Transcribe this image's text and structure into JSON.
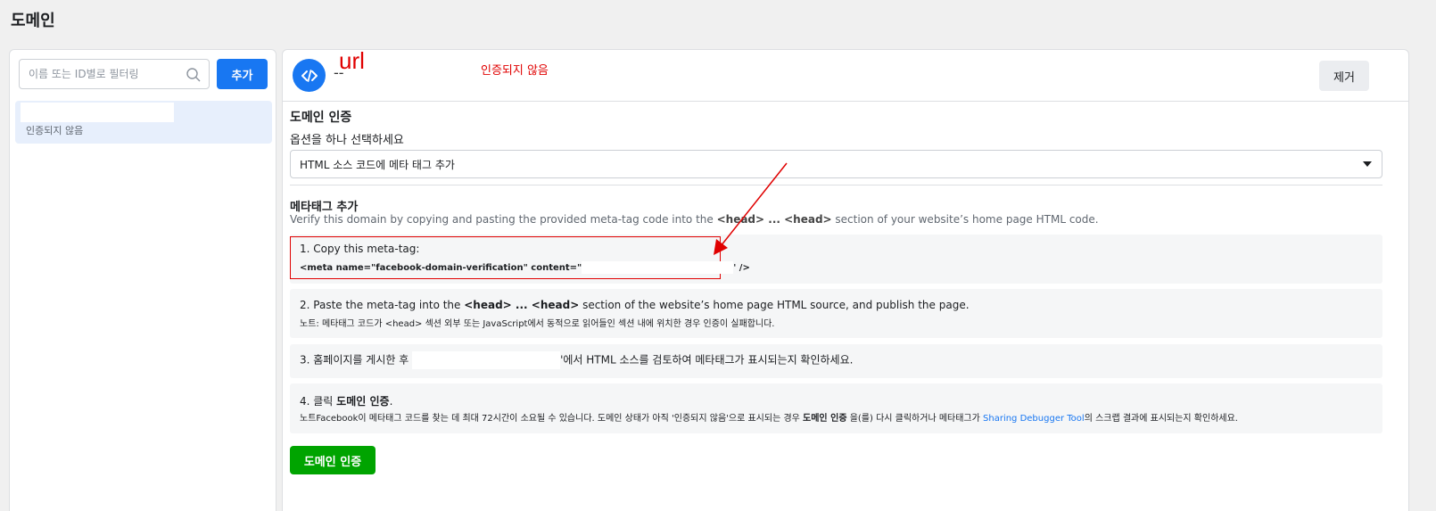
{
  "page": {
    "title": "도메인"
  },
  "sidebar": {
    "search_placeholder": "이름 또는 ID별로 필터링",
    "add_label": "추가",
    "items": [
      {
        "status": "인증되지 않음"
      }
    ]
  },
  "header": {
    "name": "--",
    "remove_label": "제거"
  },
  "annotations": {
    "url_label": "url",
    "unverified_label": "인증되지 않음",
    "color": "#e00000"
  },
  "verification": {
    "title": "도메인 인증",
    "select_label": "옵션을 하나 선택하세요",
    "selected_option": "HTML 소스 코드에 메타 태그 추가"
  },
  "metatag": {
    "title": "메타태그 추가",
    "desc_pre": "Verify this domain by copying and pasting the provided meta-tag code into the ",
    "desc_head1": "<head>",
    "desc_mid": " ... ",
    "desc_head2": "<head>",
    "desc_post": " section of your website’s home page HTML code."
  },
  "steps": {
    "s1_title": "1. Copy this meta-tag:",
    "s1_code_pre": "<meta name=\"facebook-domain-verification\" content=\"",
    "s1_code_post": "' />",
    "s2_pre": "2. Paste the meta-tag into the ",
    "s2_head1": "<head>",
    "s2_mid": " ... ",
    "s2_head2": "<head>",
    "s2_post": " section of the website’s home page HTML source, and publish the page.",
    "s2_note": "노트: 메타태그 코드가 <head> 섹션 외부 또는 JavaScript에서 동적으로 읽어들인 섹션 내에 위치한 경우 인증이 실패합니다.",
    "s3_pre": "3. 홈페이지를 게시한 후 ",
    "s3_post": "'에서 HTML 소스를 검토하여 메타태그가 표시되는지 확인하세요.",
    "s4_pre": "4. 클릭 ",
    "s4_bold": "도메인 인증",
    "s4_post": ".",
    "s4_note_pre": "노트Facebook이 메타태그 코드를 찾는 데 최대 72시간이 소요될 수 있습니다. 도메인 상태가 아직 '인증되지 않음'으로 표시되는 경우 ",
    "s4_note_bold": "도메인 인증",
    "s4_note_mid": " 을(를) 다시 클릭하거나 메타태그가 ",
    "s4_note_link": "Sharing Debugger Tool",
    "s4_note_post": "의 스크랩 결과에 표시되는지 확인하세요."
  },
  "verify_button": "도메인 인증",
  "icons": {
    "search": "search-icon",
    "code": "code-icon",
    "caret": "caret-down-icon"
  },
  "colors": {
    "primary": "#1877f2",
    "success": "#00a400",
    "annotation": "#e00000"
  }
}
